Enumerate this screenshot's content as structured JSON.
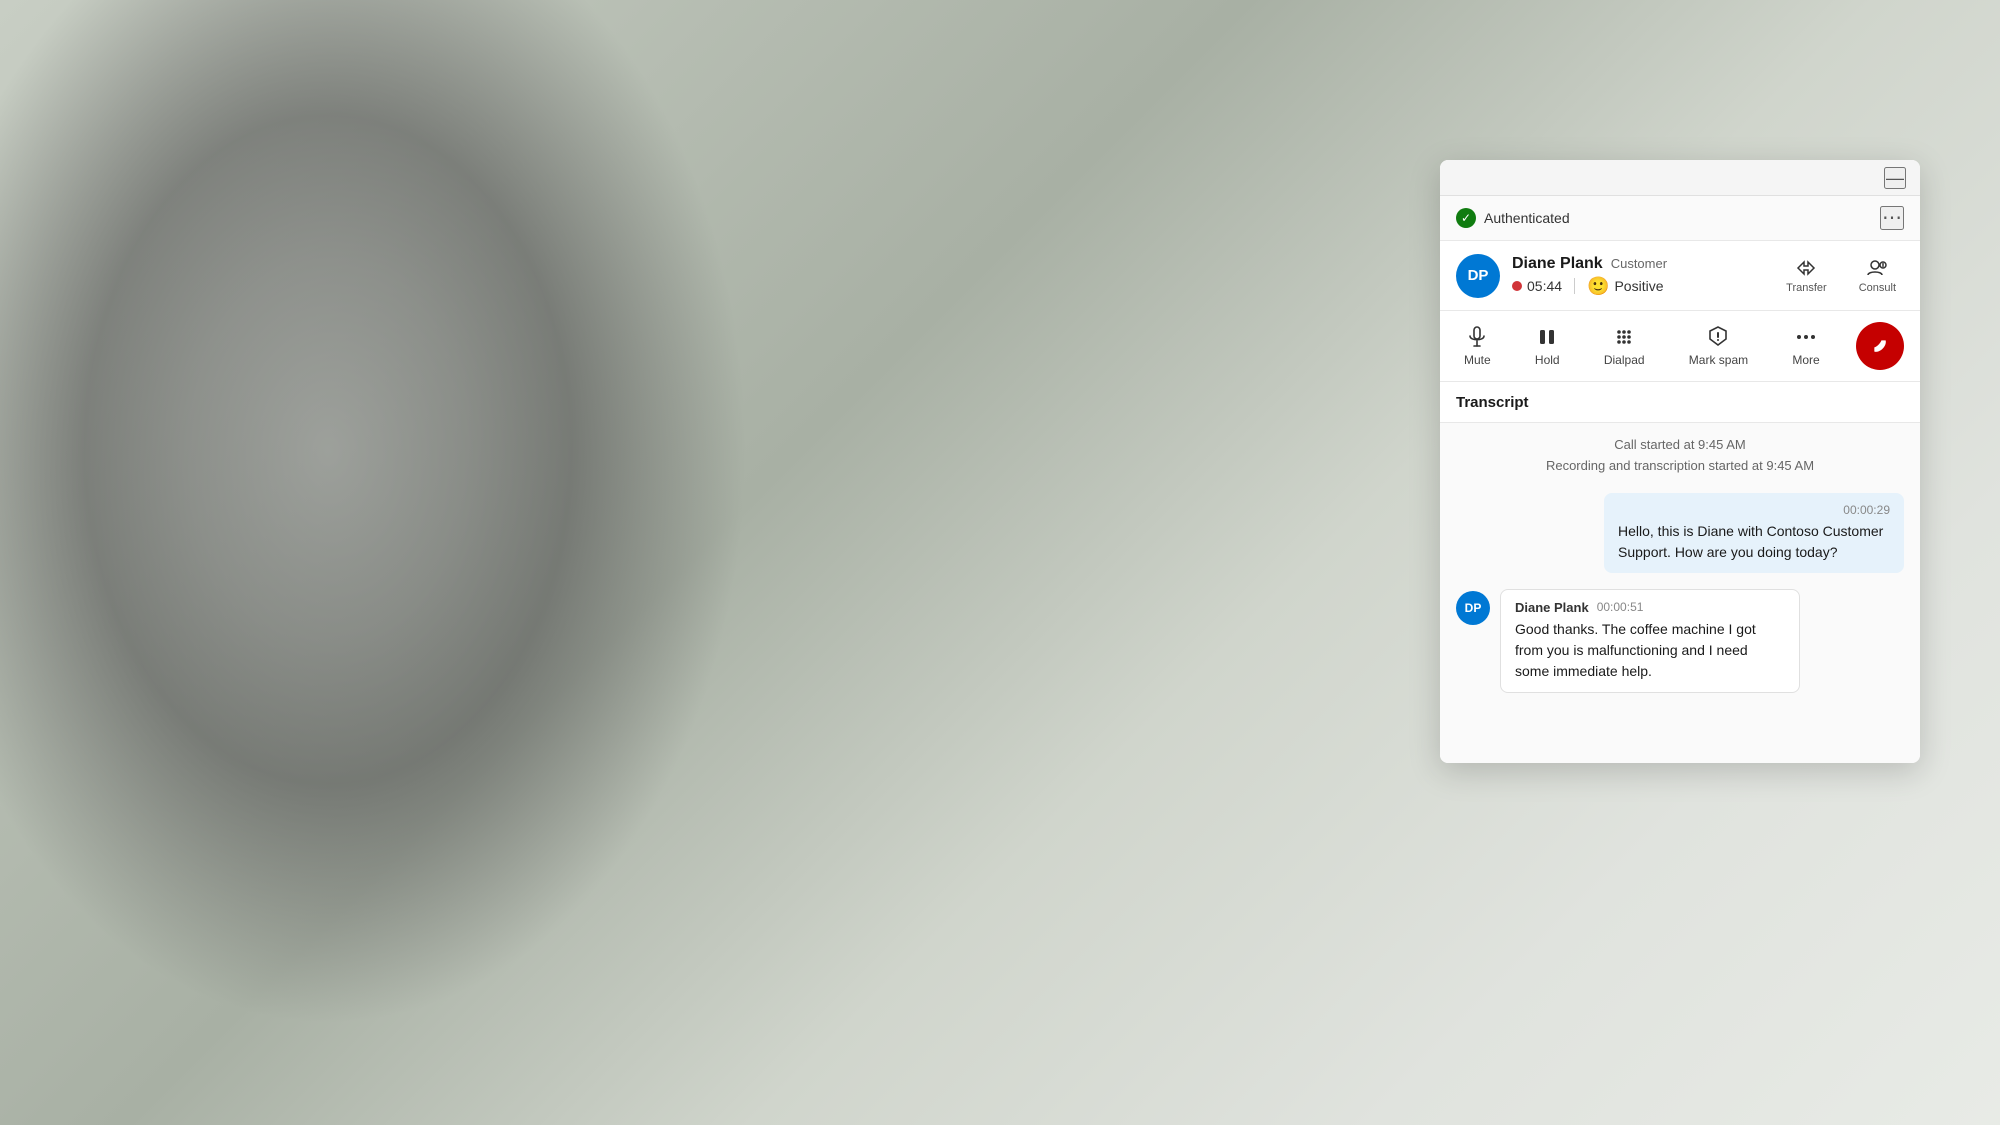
{
  "window": {
    "minimize_label": "—"
  },
  "auth": {
    "status_text": "Authenticated",
    "status_color": "#107c10",
    "more_icon": "⋯"
  },
  "contact": {
    "initials": "DP",
    "name": "Diane Plank",
    "role": "Customer",
    "timer": "05:44",
    "sentiment": "Positive",
    "transfer_label": "Transfer",
    "consult_label": "Consult"
  },
  "controls": {
    "mute_label": "Mute",
    "hold_label": "Hold",
    "dialpad_label": "Dialpad",
    "markspam_label": "Mark spam",
    "more_label": "More",
    "endcall_icon": "📞"
  },
  "transcript": {
    "title": "Transcript",
    "call_started": "Call started at 9:45 AM",
    "recording_started": "Recording and transcription started at 9:45 AM",
    "messages": [
      {
        "sender": "agent",
        "timestamp": "00:00:29",
        "text": "Hello, this is Diane with Contoso Customer Support. How are you doing today?"
      },
      {
        "sender": "customer",
        "name": "Diane Plank",
        "initials": "DP",
        "timestamp": "00:00:51",
        "text": "Good thanks. The coffee machine I got from you is malfunctioning and I need some immediate help."
      }
    ]
  }
}
